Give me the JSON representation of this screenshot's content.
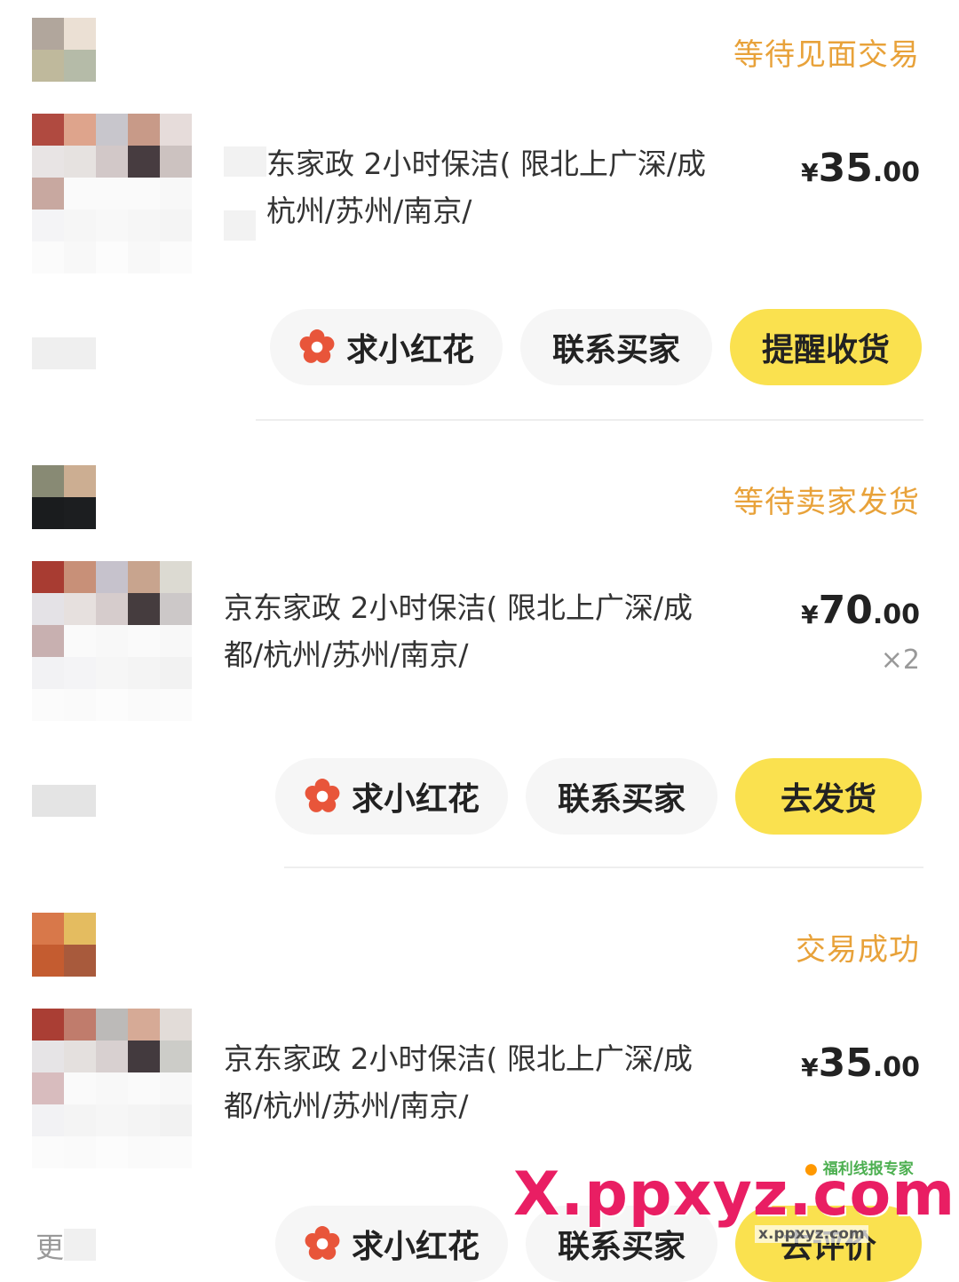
{
  "orders": [
    {
      "status": "等待见面交易",
      "title": "东家政 2小时保洁( 限北上广深/成杭州/苏州/南京/",
      "title_line1": "东家政 2小时保洁( 限北上广深/成",
      "title_line2": "杭州/苏州/南京/",
      "price_currency": "¥",
      "price_int": "35",
      "price_dec": ".00",
      "quantity": "",
      "buttons": {
        "flower": "求小红花",
        "contact": "联系买家",
        "primary": "提醒收货"
      }
    },
    {
      "status": "等待卖家发货",
      "title_line1": "京东家政 2小时保洁( 限北上广深/成",
      "title_line2": "都/杭州/苏州/南京/",
      "price_currency": "¥",
      "price_int": "70",
      "price_dec": ".00",
      "quantity": "×2",
      "buttons": {
        "flower": "求小红花",
        "contact": "联系买家",
        "primary": "去发货"
      }
    },
    {
      "status": "交易成功",
      "title_line1": "京东家政 2小时保洁( 限北上广深/成",
      "title_line2": "都/杭州/苏州/南京/",
      "price_currency": "¥",
      "price_int": "35",
      "price_dec": ".00",
      "quantity": "",
      "buttons": {
        "flower": "求小红花",
        "contact": "联系买家",
        "primary": "去评价"
      }
    }
  ],
  "more_label": "更",
  "watermark": {
    "brand": "X.ppxyz.com",
    "small": "福利线报专家",
    "url": "x.ppxyz.com"
  },
  "colors": {
    "status": "#e8a23a",
    "primary_button": "#fae14f",
    "flower": "#e8553a"
  }
}
